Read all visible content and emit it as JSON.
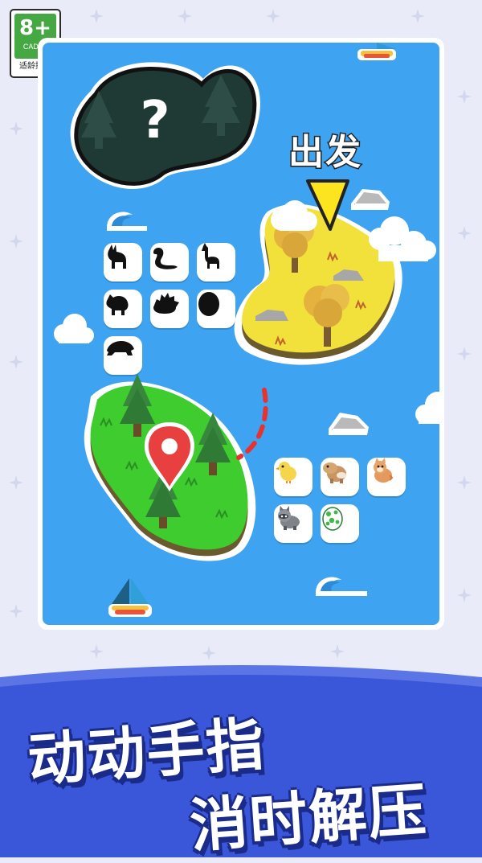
{
  "rating": {
    "age": "8+",
    "org": "CADPA",
    "tip": "适龄提示"
  },
  "map": {
    "start_label": "出发",
    "mystery_island": "?",
    "locked_animals": [
      "donkey",
      "seal",
      "llama",
      "boar",
      "hedgehog",
      "egg",
      "turtle"
    ],
    "unlocked_animals": [
      "chick",
      "capybara",
      "shiba",
      "raccoon",
      "dino-egg"
    ]
  },
  "slogan": {
    "line1": "动动手指",
    "line2": "消时解压"
  },
  "colors": {
    "ocean": "#3ea3f0",
    "banner": "#3b57d9",
    "grass": "#3fcc2f",
    "sand": "#f2e03b"
  }
}
